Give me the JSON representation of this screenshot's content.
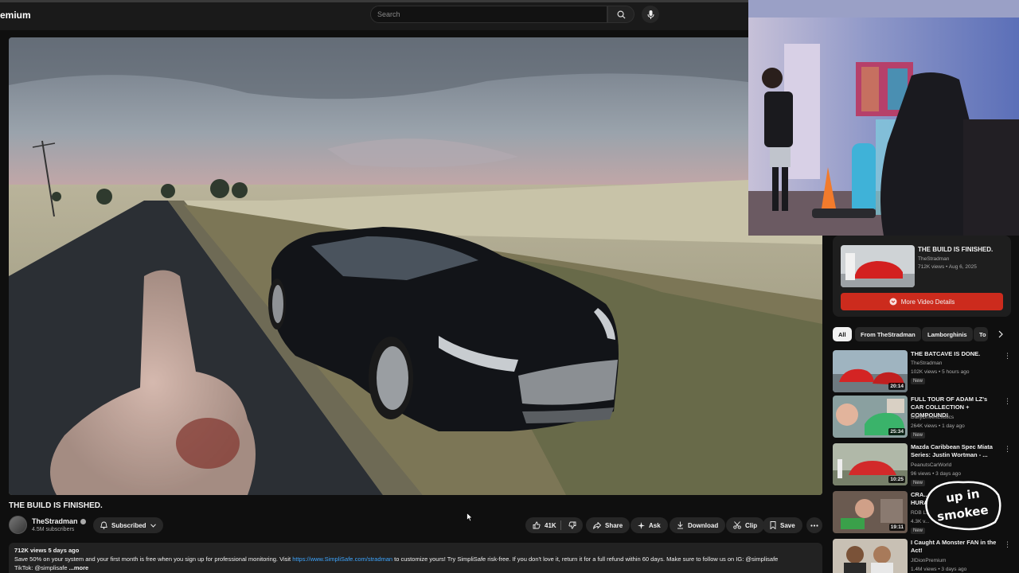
{
  "header": {
    "brand": "emium",
    "search_placeholder": "Search"
  },
  "video": {
    "title": "THE BUILD IS FINISHED.",
    "channel": "TheStradman",
    "subscribers": "4.5M subscribers",
    "subscribe_label": "Subscribed",
    "likes": "41K",
    "share_label": "Share",
    "ask_label": "Ask",
    "download_label": "Download",
    "clip_label": "Clip",
    "save_label": "Save"
  },
  "description": {
    "meta": "712K views  5 days ago",
    "text_1": "Save 50% on your system and your first month is free when you sign up for professional monitoring. Visit ",
    "link": "https://www.SimpliSafe.com/stradman",
    "text_2": " to customize yours! Try SimpliSafe risk-free. If you don't love it, return it for a full refund within 60 days. Make sure to follow us on IG: @simplisafe",
    "text_3": "TikTok: @simplisafe ",
    "more": "...more"
  },
  "now_playing": {
    "title": "THE BUILD IS FINISHED.",
    "channel": "TheStradman",
    "meta": "712K views • Aug 6, 2025",
    "details_label": "More Video Details"
  },
  "chips": [
    "All",
    "From TheStradman",
    "Lamborghinis",
    "To"
  ],
  "recommendations": [
    {
      "title": "THE BATCAVE IS DONE.",
      "channel": "TheStradman",
      "meta": "102K views • 5 hours ago",
      "badge": "New",
      "duration": "20:14"
    },
    {
      "title": "FULL TOUR OF ADAM LZ's CAR COLLECTION + COMPOUND!",
      "channel": "DailyDrivenExotics",
      "meta": "264K views • 1 day ago",
      "badge": "New",
      "duration": "25:34"
    },
    {
      "title": "Mazda Caribbean Spec Miata Series: Justin Wortman - ...",
      "channel": "PeanutsCarWorld",
      "meta": "96 views • 3 days ago",
      "badge": "New",
      "duration": "10:25"
    },
    {
      "title": "CRA... HURA...",
      "channel": "RDB L...",
      "meta": "4.3K v...",
      "badge": "New",
      "duration": "19:11"
    },
    {
      "title": "I Caught A Monster FAN in the Act!",
      "channel": "JIDionPremium",
      "meta": "1.4M views • 3 days ago",
      "badge": "",
      "duration": ""
    }
  ],
  "overlay": {
    "logo_text": "upin smokee"
  }
}
